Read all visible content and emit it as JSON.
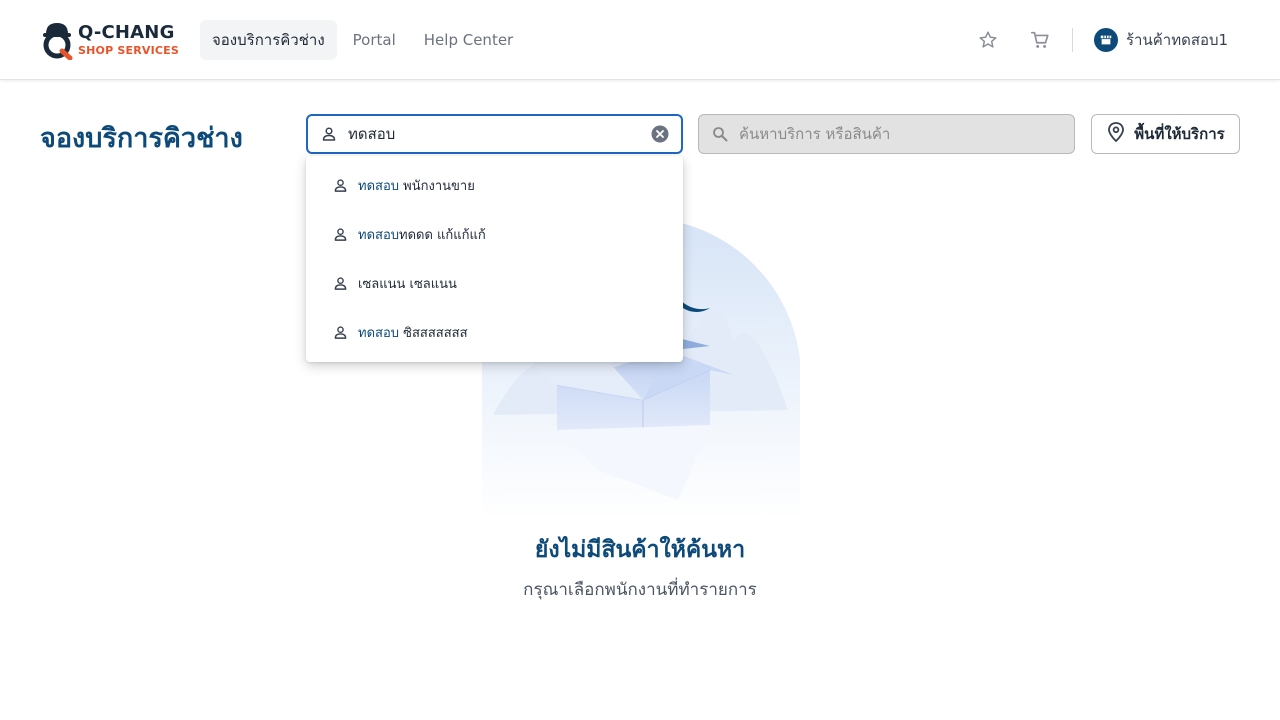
{
  "header": {
    "logo_top": "Q-CHANG",
    "logo_bottom": "SHOP SERVICES",
    "nav": [
      {
        "label": "จองบริการคิวช่าง",
        "active": true
      },
      {
        "label": "Portal",
        "active": false
      },
      {
        "label": "Help Center",
        "active": false
      }
    ],
    "icons": [
      "star-icon",
      "cart-icon",
      "store-icon"
    ],
    "shop_name": "ร้านค้าทดสอบ1"
  },
  "page": {
    "title": "จองบริการคิวช่าง"
  },
  "employee_search": {
    "value": "ทดสอบ",
    "icon": "person-icon",
    "clear_icon": "clear-circle-icon"
  },
  "product_search": {
    "placeholder": "ค้นหาบริการ หรือสินค้า",
    "icon": "search-icon"
  },
  "area_button": {
    "label": "พื้นที่ให้บริการ",
    "icon": "location-pin-icon"
  },
  "dropdown": {
    "items": [
      {
        "highlight": "ทดสอบ",
        "rest": " พนักงานขาย"
      },
      {
        "highlight": "ทดสอบ",
        "rest": "ทดดด แก้แก้แก้"
      },
      {
        "highlight": "",
        "rest": "เซลแนน เซลแนน"
      },
      {
        "highlight": "ทดสอบ",
        "rest": " ซิสสสสสสส"
      }
    ]
  },
  "empty_state": {
    "title": "ยังไม่มีสินค้าให้ค้นหา",
    "subtitle": "กรุณาเลือกพนักงานที่ทำรายการ"
  },
  "colors": {
    "brand_navy": "#0d4a7a",
    "brand_orange": "#e8542a",
    "focus_blue": "#1e67c2"
  }
}
